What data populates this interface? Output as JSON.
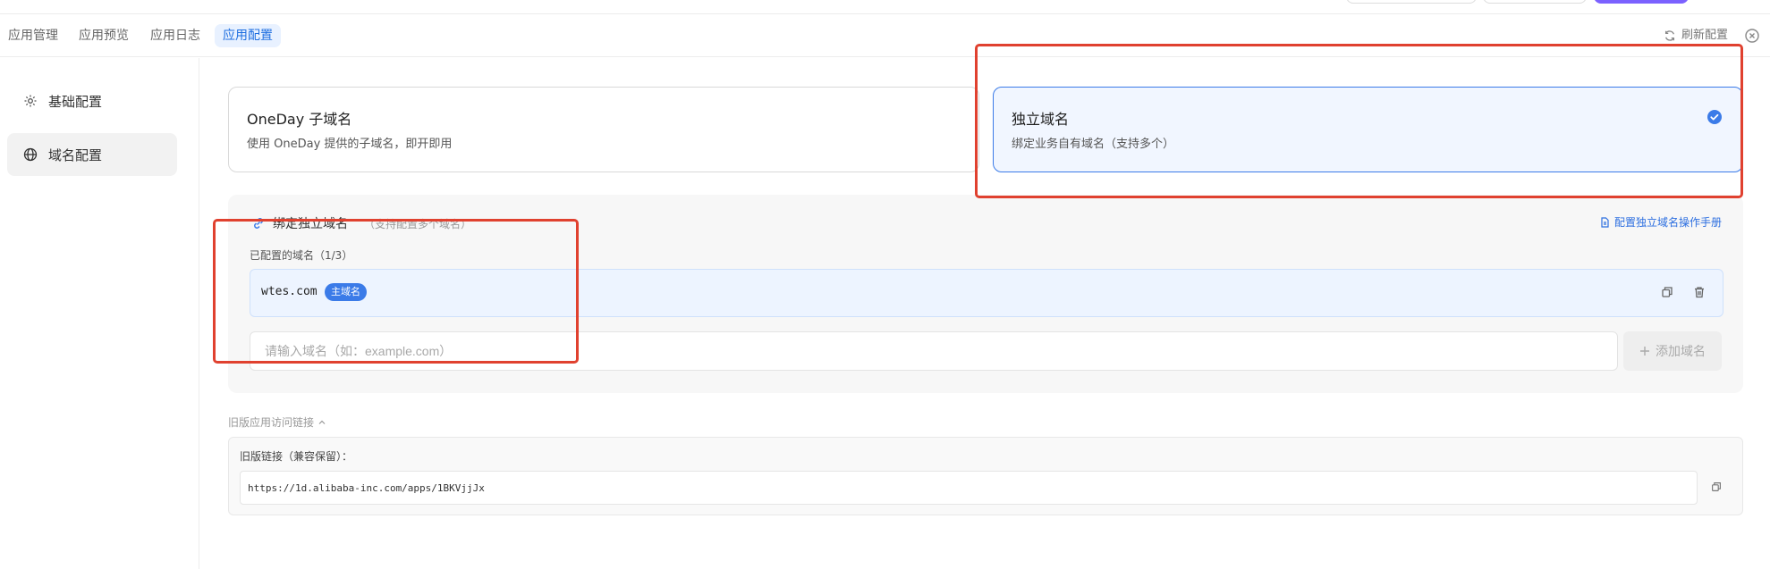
{
  "tabs": {
    "items": [
      {
        "label": "应用管理"
      },
      {
        "label": "应用预览"
      },
      {
        "label": "应用日志"
      },
      {
        "label": "应用配置"
      }
    ],
    "refresh_label": "刷新配置"
  },
  "sidebar": {
    "items": [
      {
        "label": "基础配置",
        "icon": "gear-icon"
      },
      {
        "label": "域名配置",
        "icon": "globe-icon"
      }
    ]
  },
  "options": {
    "subdomain": {
      "title": "OneDay 子域名",
      "desc": "使用 OneDay 提供的子域名，即开即用"
    },
    "custom": {
      "title": "独立域名",
      "desc": "绑定业务自有域名（支持多个）",
      "selected": true
    }
  },
  "binding": {
    "title": "绑定独立域名",
    "subtitle": "（支持配置多个域名）",
    "manual_link": "配置独立域名操作手册",
    "configured_label": "已配置的域名（1/3）",
    "domains": [
      {
        "name": "wtes.com",
        "badge": "主域名"
      }
    ],
    "input_placeholder": "请输入域名（如：example.com）",
    "add_label": "添加域名"
  },
  "legacy": {
    "toggle_label": "旧版应用访问链接",
    "label": "旧版链接（兼容保留）：",
    "url": "https://1d.alibaba-inc.com/apps/1BKVjjJx"
  },
  "colors": {
    "accent": "#3b7be8",
    "annotation": "#e0412f"
  }
}
